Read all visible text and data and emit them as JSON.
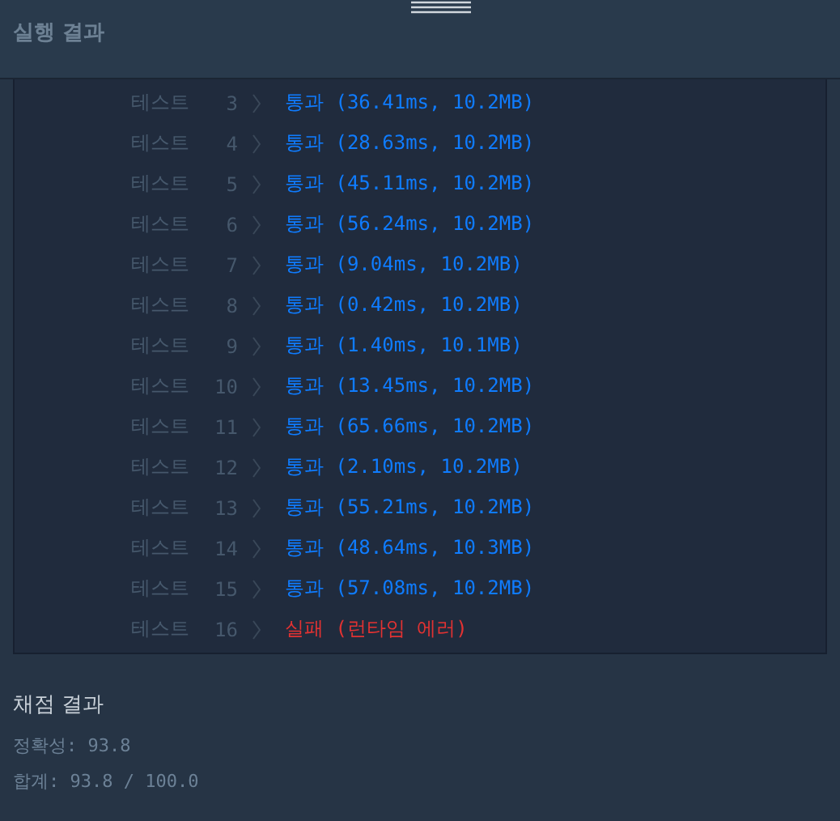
{
  "header": {
    "title": "실행 결과"
  },
  "tests": [
    {
      "label": "테스트",
      "number": "3",
      "kind": "pass",
      "result": "통과",
      "detail": "(36.41ms, 10.2MB)"
    },
    {
      "label": "테스트",
      "number": "4",
      "kind": "pass",
      "result": "통과",
      "detail": "(28.63ms, 10.2MB)"
    },
    {
      "label": "테스트",
      "number": "5",
      "kind": "pass",
      "result": "통과",
      "detail": "(45.11ms, 10.2MB)"
    },
    {
      "label": "테스트",
      "number": "6",
      "kind": "pass",
      "result": "통과",
      "detail": "(56.24ms, 10.2MB)"
    },
    {
      "label": "테스트",
      "number": "7",
      "kind": "pass",
      "result": "통과",
      "detail": "(9.04ms, 10.2MB)"
    },
    {
      "label": "테스트",
      "number": "8",
      "kind": "pass",
      "result": "통과",
      "detail": "(0.42ms, 10.2MB)"
    },
    {
      "label": "테스트",
      "number": "9",
      "kind": "pass",
      "result": "통과",
      "detail": "(1.40ms, 10.1MB)"
    },
    {
      "label": "테스트",
      "number": "10",
      "kind": "pass",
      "result": "통과",
      "detail": "(13.45ms, 10.2MB)"
    },
    {
      "label": "테스트",
      "number": "11",
      "kind": "pass",
      "result": "통과",
      "detail": "(65.66ms, 10.2MB)"
    },
    {
      "label": "테스트",
      "number": "12",
      "kind": "pass",
      "result": "통과",
      "detail": "(2.10ms, 10.2MB)"
    },
    {
      "label": "테스트",
      "number": "13",
      "kind": "pass",
      "result": "통과",
      "detail": "(55.21ms, 10.2MB)"
    },
    {
      "label": "테스트",
      "number": "14",
      "kind": "pass",
      "result": "통과",
      "detail": "(48.64ms, 10.3MB)"
    },
    {
      "label": "테스트",
      "number": "15",
      "kind": "pass",
      "result": "통과",
      "detail": "(57.08ms, 10.2MB)"
    },
    {
      "label": "테스트",
      "number": "16",
      "kind": "fail",
      "result": "실패",
      "detail": "(런타임 에러)"
    }
  ],
  "grading": {
    "title": "채점 결과",
    "lines": [
      "정확성: 93.8",
      "합계: 93.8 / 100.0"
    ]
  }
}
